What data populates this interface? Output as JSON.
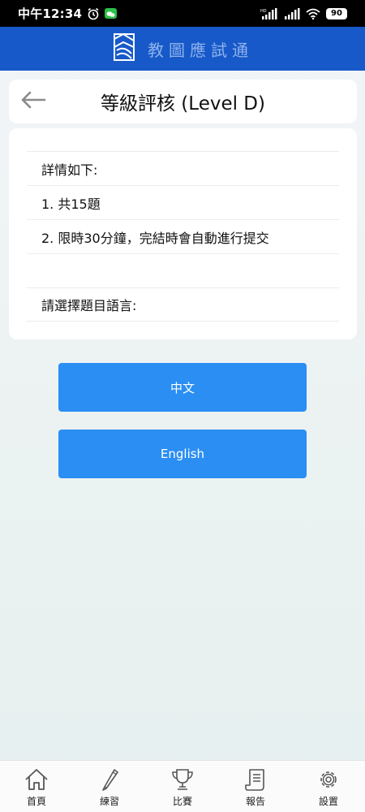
{
  "status_bar": {
    "time": "中午12:34",
    "battery": "90",
    "network": "HD"
  },
  "app": {
    "title": "教圖應試通",
    "accent": "#1759c9",
    "button_color": "#2b8ef3"
  },
  "page": {
    "title": "等級評核 (Level D)"
  },
  "info": {
    "heading": "詳情如下:",
    "line1": "1. 共15題",
    "line2": "2. 限時30分鐘，完結時會自動進行提交",
    "blank": "",
    "prompt": "請選擇題目語言:"
  },
  "languages": {
    "chinese": "中文",
    "english": "English"
  },
  "nav": {
    "items": [
      {
        "label": "首頁",
        "icon": "home-icon"
      },
      {
        "label": "練習",
        "icon": "pencil-icon"
      },
      {
        "label": "比賽",
        "icon": "trophy-icon"
      },
      {
        "label": "報告",
        "icon": "scroll-icon"
      },
      {
        "label": "設置",
        "icon": "gear-icon"
      }
    ]
  }
}
